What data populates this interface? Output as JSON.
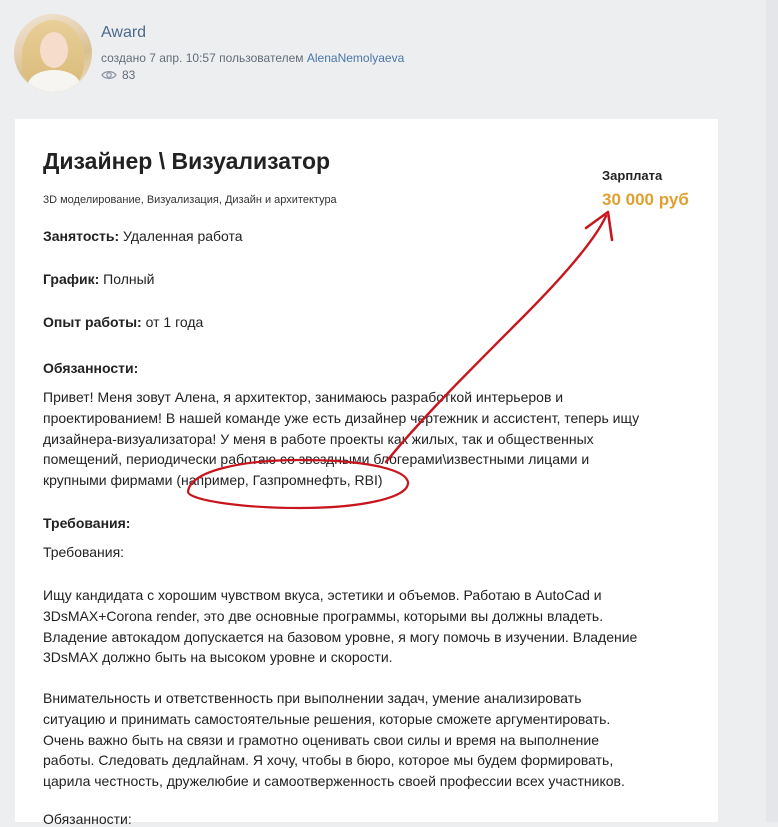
{
  "post": {
    "title": "Award",
    "meta_prefix": "создано 7 апр. 10:57 пользователем",
    "author": "AlenaNemolyaeva",
    "views": "83"
  },
  "job": {
    "title": "Дизайнер \\ Визуализатор",
    "tags": "3D моделирование, Визуализация, Дизайн и архитектура",
    "salary_label": "Зарплата",
    "salary_value": "30 000 руб",
    "employment_label": "Занятость:",
    "employment_value": "Удаленная работа",
    "schedule_label": "График:",
    "schedule_value": "Полный",
    "experience_label": "Опыт работы:",
    "experience_value": "от 1 года",
    "duties_heading": "Обязанности:",
    "duties_lines": [
      "Привет! Меня зовут Алена, я архитектор, занимаюсь разработкой интерьеров и",
      "проектированием! В нашей команде уже есть дизайнер чертежник и ассистент, теперь ищу",
      "дизайнера-визуализатора! У меня в работе проекты как жилых, так и общественных",
      "помещений, периодически работаю со звездными блогерами\\известными лицами и",
      "крупными фирмами (например, Газпромнефть, RBI)"
    ],
    "requirements_heading": "Требования:",
    "requirements_subheading": "Требования:",
    "requirements_p1": [
      "Ищу кандидата с хорошим чувством вкуса, эстетики и объемов. Работаю в AutoCad и",
      "3DsMAX+Corona render, это две основные программы, которыми вы должны владеть.",
      "Владение автокадом допускается на базовом уровне, я могу помочь в изучении. Владение",
      "3DsMAX должно быть на высоком уровне и скорости."
    ],
    "requirements_p2": [
      "Внимательность и ответственность при выполнении задач, умение анализировать",
      "ситуацию и принимать самостоятельные решения, которые сможете аргументировать.",
      "Очень важно быть на связи и грамотно оценивать свои силы и время на выполнение",
      "работы. Следовать дедлайнам. Я хочу, чтобы в бюро, которое мы будем формировать,",
      "царила честность, дружелюбие и самоотверженность своей профессии всех участников."
    ],
    "cut_heading": "Обязанности:"
  },
  "icons": {
    "views": "eye-icon",
    "annotation": "red-hand-drawn-arrow"
  },
  "colors": {
    "salary": "#e0a030",
    "link": "#4a76a8",
    "annotation": "#c8161e"
  }
}
